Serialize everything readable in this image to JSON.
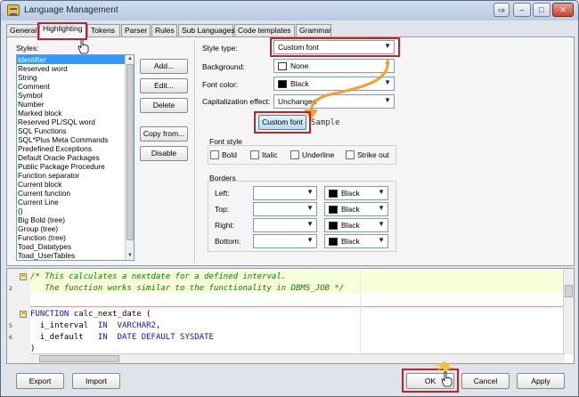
{
  "window": {
    "title": "Language Management"
  },
  "titlebar_buttons": [
    "‹»",
    "–",
    "□",
    "✕"
  ],
  "tabs": [
    {
      "label": "General",
      "active": false
    },
    {
      "label": "Highlighting",
      "active": true
    },
    {
      "label": "Tokens",
      "active": false
    },
    {
      "label": "Parser",
      "active": false
    },
    {
      "label": "Rules",
      "active": false
    },
    {
      "label": "Sub Languages",
      "active": false
    },
    {
      "label": "Code templates",
      "active": false
    },
    {
      "label": "Grammar",
      "active": false
    }
  ],
  "styles": {
    "label": "Styles:",
    "items": [
      "Identifier",
      "Reserved word",
      "String",
      "Comment",
      "Symbol",
      "Number",
      "Marked block",
      "Reserved PL/SQL word",
      "SQL Functions",
      "SQL*Plus Meta Commands",
      "Predefined Exceptions",
      "Default Oracle Packages",
      "Public Package Procedure",
      "Function separator",
      "Current block",
      "Current function",
      "Current Line",
      "()",
      "Big Bold (tree)",
      "Group (tree)",
      "Function (tree)",
      "Toad_Datatypes",
      "Toad_UserTables"
    ],
    "selected_index": 0
  },
  "style_buttons": {
    "add": "Add...",
    "edit": "Edit...",
    "delete": "Delete",
    "copy_from": "Copy from...",
    "disable": "Disable"
  },
  "props": {
    "style_type_label": "Style type:",
    "style_type_value": "Custom font",
    "background_label": "Background:",
    "background_value": "None",
    "background_swatch": "#ffffff",
    "font_color_label": "Font color:",
    "font_color_value": "Black",
    "font_color_swatch": "#000000",
    "cap_effect_label": "Capitalization effect:",
    "cap_effect_value": "Unchanged",
    "custom_font_button": "Custom font",
    "sample_text": "Sample"
  },
  "font_style": {
    "title": "Font style",
    "bold": "Bold",
    "italic": "Italic",
    "underline": "Underline",
    "strike_out": "Strike out"
  },
  "borders": {
    "title": "Borders",
    "rows": [
      {
        "label": "Left:",
        "color": "Black"
      },
      {
        "label": "Top:",
        "color": "Black"
      },
      {
        "label": "Right:",
        "color": "Black"
      },
      {
        "label": "Bottom:",
        "color": "Black"
      }
    ]
  },
  "editor": {
    "lines": [
      {
        "num": "",
        "text": "/* This calculates a nextdate for a defined interval."
      },
      {
        "num": "2",
        "text": "   The function works similar to the functionality in DBMS_JOB */"
      },
      {
        "num": "",
        "text": "FUNCTION calc_next_date ("
      },
      {
        "num": "5",
        "text": "  i_interval  IN  VARCHAR2,"
      },
      {
        "num": "6",
        "text": "  i_default   IN  DATE DEFAULT SYSDATE"
      },
      {
        "num": "",
        "text": ")"
      }
    ],
    "keywords": [
      "FUNCTION",
      "IN",
      "VARCHAR2",
      "DATE",
      "DEFAULT",
      "SYSDATE"
    ]
  },
  "footer": {
    "export": "Export",
    "import": "Import",
    "ok": "OK",
    "cancel": "Cancel",
    "apply": "Apply"
  },
  "colors": {
    "accent_red": "#c0242b",
    "selection": "#3399ff",
    "callout_orange": "#f2a22a",
    "comment_green": "#0a7d0a",
    "keyword_blue": "#1010c8"
  }
}
